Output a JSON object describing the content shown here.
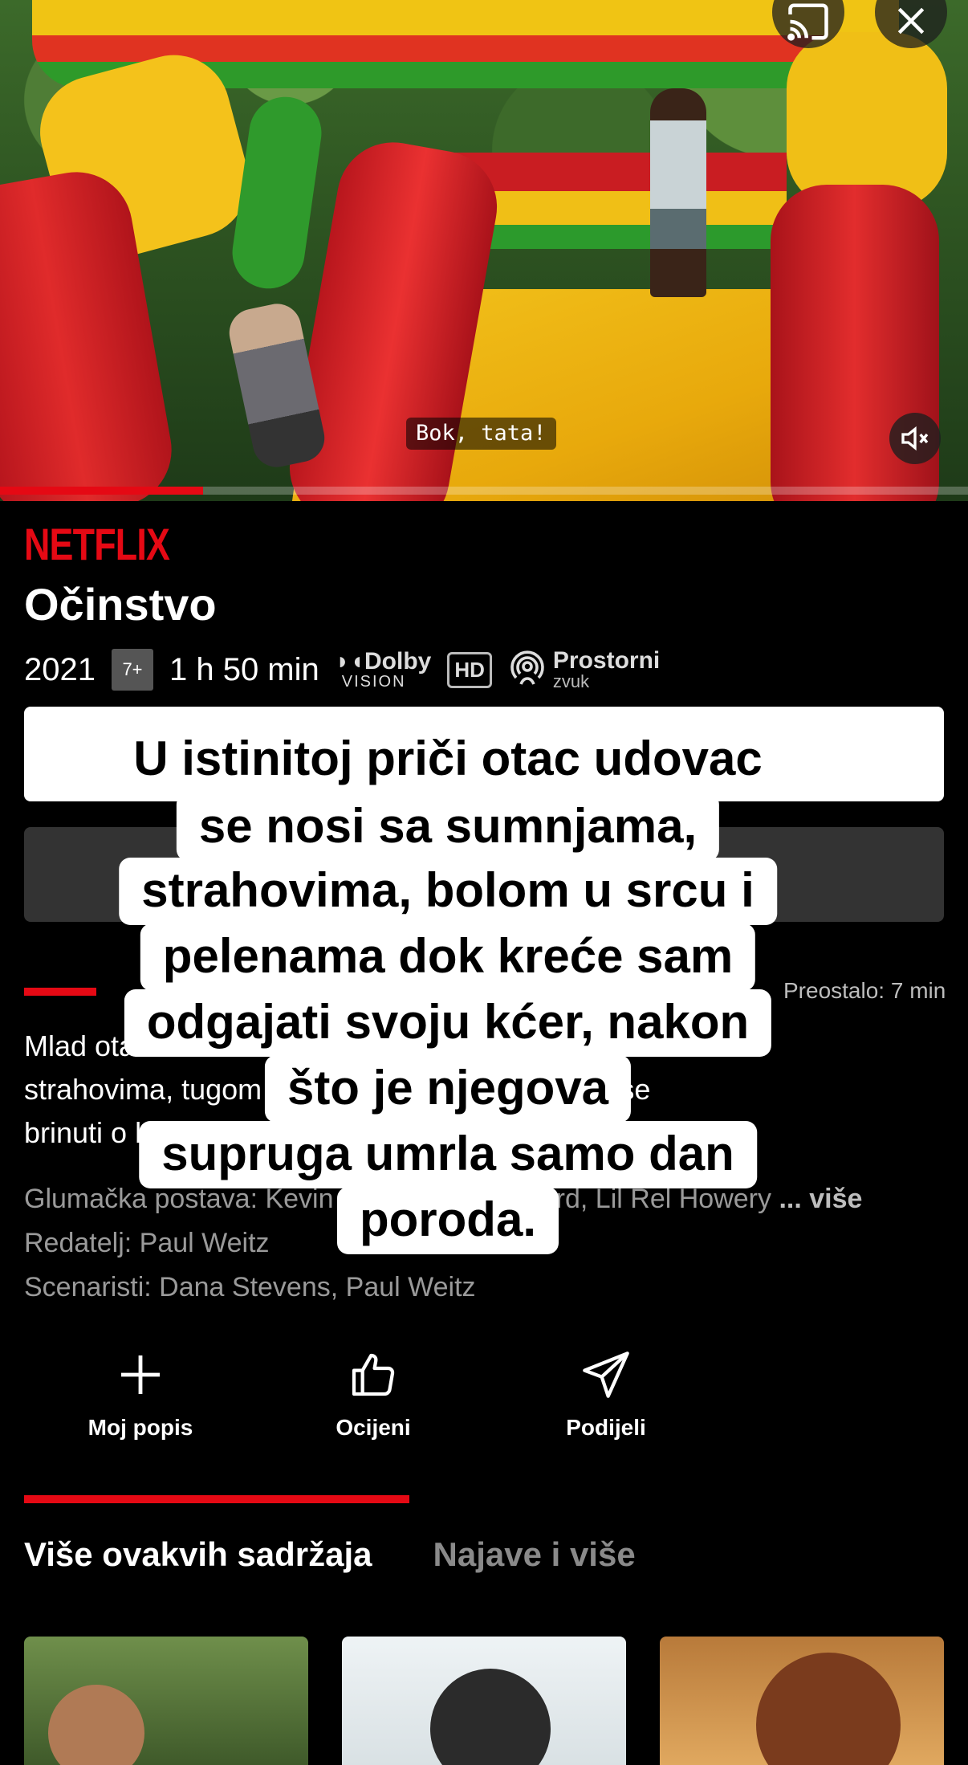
{
  "video": {
    "subtitle": "Bok, tata!",
    "progress_percent": 21
  },
  "brand": "NETFLIX",
  "title": "Očinstvo",
  "meta": {
    "year": "2021",
    "age_rating": "7+",
    "duration": "1 h 50 min",
    "dolby_top": "Dolby",
    "dolby_bottom": "VISION",
    "hd": "HD",
    "spatial_top": "Prostorni",
    "spatial_bottom": "zvuk"
  },
  "episode": {
    "remaining": "Preostalo: 7 min"
  },
  "description": {
    "line1": "Mlad otac udovac suočava se sa sumnjama,",
    "line2": "strahovima, tugom i pelenama kad odluči sam se",
    "line3": "brinuti o kćeri nakon smrti žene pri porođaju u priči."
  },
  "credits": {
    "cast": "Glumačka postava: Kevin Hart, Alfre Woodard, Lil Rel Howery",
    "more": "... više",
    "director": "Redatelj: Paul Weitz",
    "writers": "Scenaristi: Dana Stevens, Paul Weitz"
  },
  "caption": {
    "lines": [
      "U istinitoj priči otac udovac",
      "se nosi sa sumnjama,",
      "strahovima, bolom u srcu i",
      "pelenama dok kreće sam",
      "odgajati svoju kćer, nakon",
      "što je njegova",
      "supruga umrla samo dan",
      "poroda."
    ]
  },
  "actions": {
    "my_list": "Moj popis",
    "rate": "Ocijeni",
    "share": "Podijeli"
  },
  "tabs": {
    "more_like_this": "Više ovakvih sadržaja",
    "trailers": "Najave i više"
  },
  "colors": {
    "accent": "#e50914",
    "background": "#000000"
  }
}
